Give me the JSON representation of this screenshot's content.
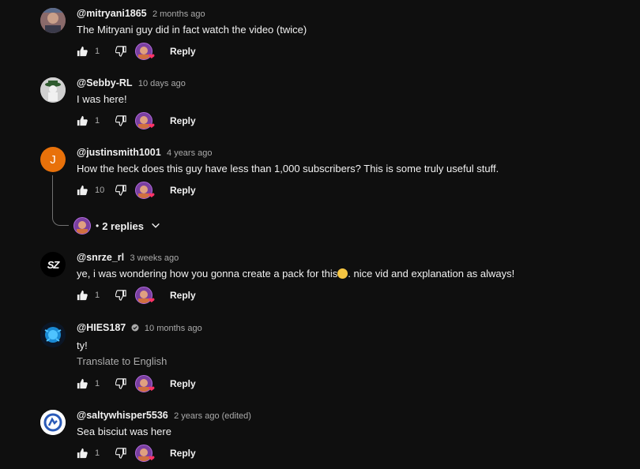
{
  "comments": [
    {
      "author": "@mitryani1865",
      "time": "2 months ago",
      "text": "The Mitryani guy did in fact watch the video (twice)",
      "likes": "1",
      "reply": "Reply"
    },
    {
      "author": "@Sebby-RL",
      "time": "10 days ago",
      "text": "I was here!",
      "likes": "1",
      "reply": "Reply"
    },
    {
      "author": "@justinsmith1001",
      "time": "4 years ago",
      "text": "How the heck does this guy have less than 1,000 subscribers?  This is some truly useful stuff.",
      "likes": "10",
      "reply": "Reply",
      "avatar_letter": "J",
      "replies_label": "2 replies"
    },
    {
      "author": "@snrze_rl",
      "time": "3 weeks ago",
      "text_before": "ye, i was wondering how you gonna create a pack for this",
      "text_after": ". nice vid and explanation as always!",
      "likes": "1",
      "reply": "Reply",
      "avatar_text": "SZ"
    },
    {
      "author": "@HIES187",
      "time": "10 months ago",
      "text": "ty!",
      "translate": "Translate to English",
      "likes": "1",
      "reply": "Reply"
    },
    {
      "author": "@saltywhisper5536",
      "time": "2 years ago (edited)",
      "text": "Sea bisciut was here",
      "likes": "1",
      "reply": "Reply"
    }
  ],
  "colors": {
    "background": "#0f0f0f",
    "text": "#f1f1f1",
    "secondary": "#aaaaaa",
    "avatar_orange": "#e8710a",
    "heart": "#ff3366"
  },
  "icons": [
    "like-icon",
    "dislike-icon",
    "heart-icon",
    "chevron-down-icon",
    "verified-icon"
  ]
}
